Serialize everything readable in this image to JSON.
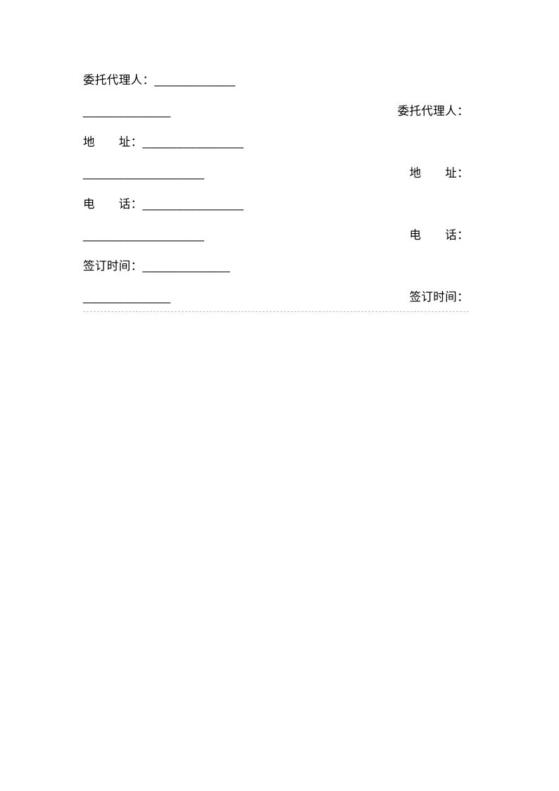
{
  "document": {
    "page_number_visible": false,
    "background_color": "#ffffff",
    "text_color": "#000000",
    "divider_color": "#bfbfbf"
  },
  "fields": [
    {
      "name": "authorized-agent",
      "left_label": "委托代理人：",
      "left_rule": "____________",
      "continuation_rule": "_____________",
      "right_label": "委托代理人：",
      "right_rule": ""
    },
    {
      "name": "address",
      "left_label": "地　　址：",
      "left_rule": "_______________",
      "continuation_rule": "__________________",
      "right_label": "地　　址：",
      "right_rule": ""
    },
    {
      "name": "telephone",
      "left_label": "电　　话：",
      "left_rule": "_______________",
      "continuation_rule": "__________________",
      "right_label": "电　　话：",
      "right_rule": ""
    },
    {
      "name": "signing-date",
      "left_label": "签订时间：",
      "left_rule": "_____________",
      "continuation_rule": "_____________",
      "right_label": "签订时间：",
      "right_rule": ""
    }
  ]
}
